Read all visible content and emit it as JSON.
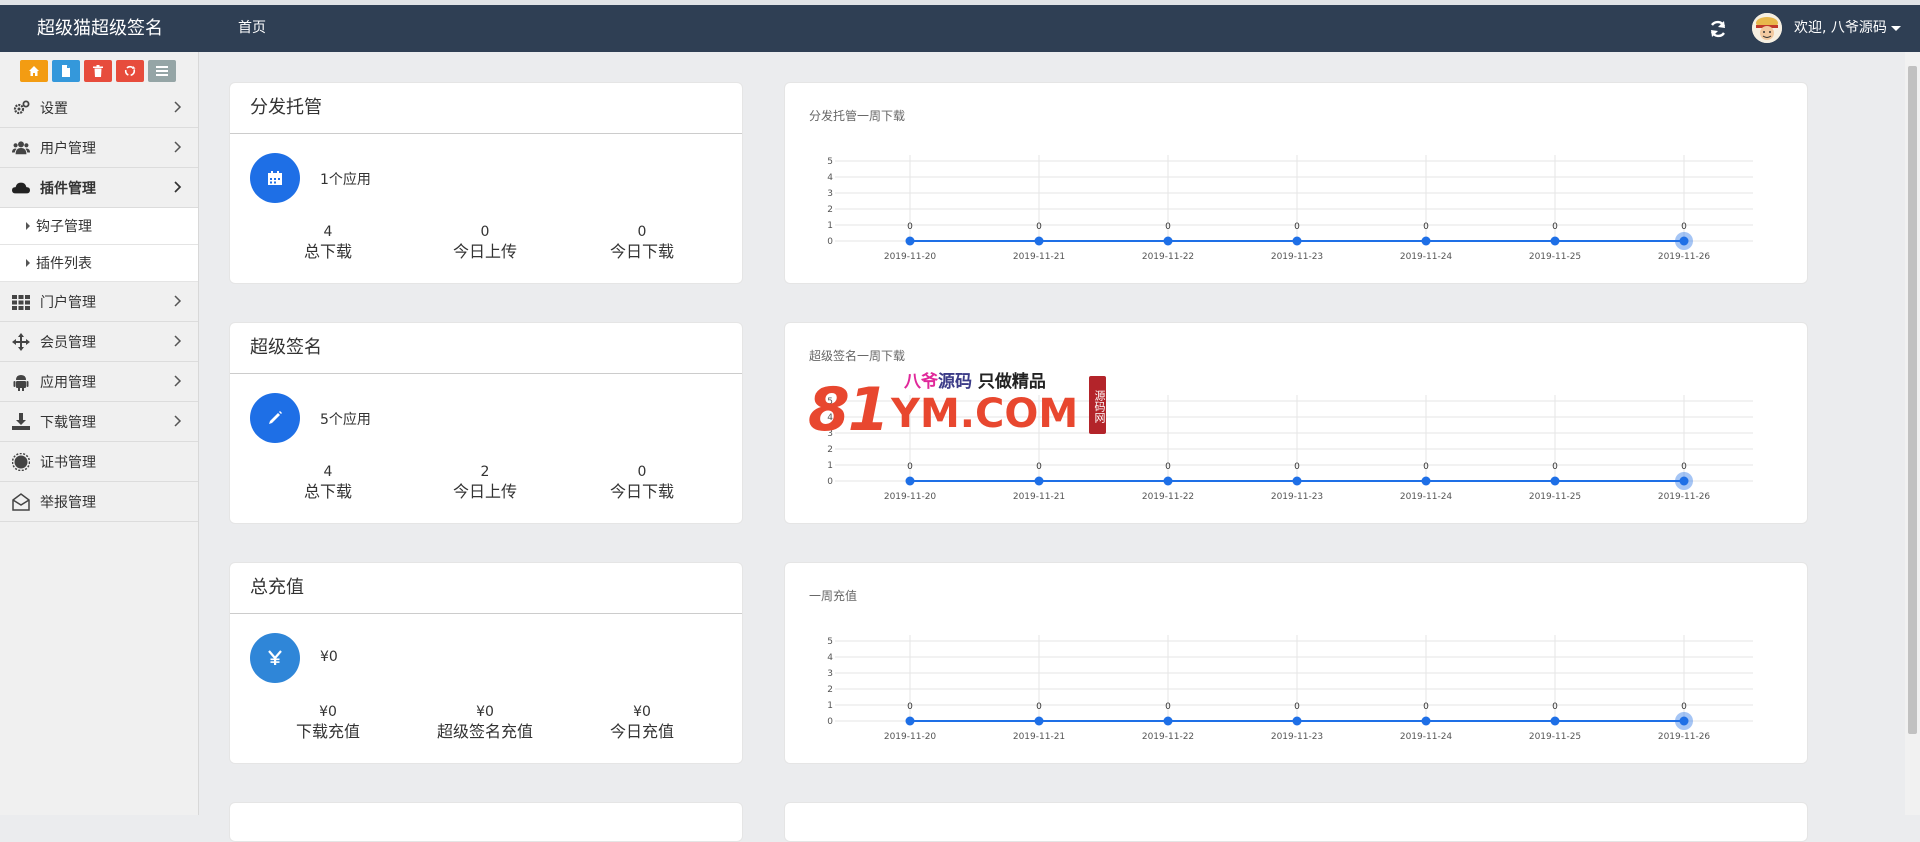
{
  "app": {
    "brand": "超级猫超级签名",
    "nav_home": "首页",
    "welcome": "欢迎, 八爷源码"
  },
  "shortcuts": [
    {
      "icon": "home-icon",
      "color": "#f39c12"
    },
    {
      "icon": "file-icon",
      "color": "#3498db"
    },
    {
      "icon": "trash-icon",
      "color": "#e74c3c"
    },
    {
      "icon": "recycle-icon",
      "color": "#e74c3c"
    },
    {
      "icon": "list-icon",
      "color": "#95a5a6"
    }
  ],
  "sidebar": {
    "items": [
      {
        "label": "设置",
        "icon": "cogs-icon",
        "chevron": true
      },
      {
        "label": "用户管理",
        "icon": "users-icon",
        "chevron": true
      },
      {
        "label": "插件管理",
        "icon": "cloud-icon",
        "chevron": true,
        "active": true
      },
      {
        "label": "门户管理",
        "icon": "grid-icon",
        "chevron": true
      },
      {
        "label": "会员管理",
        "icon": "move-icon",
        "chevron": true
      },
      {
        "label": "应用管理",
        "icon": "android-icon",
        "chevron": true
      },
      {
        "label": "下载管理",
        "icon": "download-icon",
        "chevron": true
      },
      {
        "label": "证书管理",
        "icon": "certificate-icon",
        "chevron": false
      },
      {
        "label": "举报管理",
        "icon": "envelope-icon",
        "chevron": false
      }
    ],
    "sub_items": [
      {
        "label": "钩子管理"
      },
      {
        "label": "插件列表"
      }
    ]
  },
  "stats": [
    {
      "title": "分发托管",
      "icon": "calendar-icon",
      "count": "1个应用",
      "cols": [
        {
          "value": "4",
          "label": "总下载"
        },
        {
          "value": "0",
          "label": "今日上传"
        },
        {
          "value": "0",
          "label": "今日下载"
        }
      ]
    },
    {
      "title": "超级签名",
      "icon": "pencil-icon",
      "count": "5个应用",
      "cols": [
        {
          "value": "4",
          "label": "总下载"
        },
        {
          "value": "2",
          "label": "今日上传"
        },
        {
          "value": "0",
          "label": "今日下载"
        }
      ]
    },
    {
      "title": "总充值",
      "icon": "yen-icon",
      "count": "¥0",
      "cols": [
        {
          "value": "¥0",
          "label": "下载充值"
        },
        {
          "value": "¥0",
          "label": "超级签名充值"
        },
        {
          "value": "¥0",
          "label": "今日充值"
        }
      ]
    }
  ],
  "chart_data": [
    {
      "type": "line",
      "title": "分发托管一周下载",
      "categories": [
        "2019-11-20",
        "2019-11-21",
        "2019-11-22",
        "2019-11-23",
        "2019-11-24",
        "2019-11-25",
        "2019-11-26"
      ],
      "values": [
        0,
        0,
        0,
        0,
        0,
        0,
        0
      ],
      "ylim": [
        0,
        5
      ],
      "yticks": [
        "0",
        "1",
        "2",
        "3",
        "4",
        "5"
      ],
      "grid": true,
      "line_color": "#1e6fe6"
    },
    {
      "type": "line",
      "title": "超级签名一周下载",
      "categories": [
        "2019-11-20",
        "2019-11-21",
        "2019-11-22",
        "2019-11-23",
        "2019-11-24",
        "2019-11-25",
        "2019-11-26"
      ],
      "values": [
        0,
        0,
        0,
        0,
        0,
        0,
        0
      ],
      "ylim": [
        0,
        5
      ],
      "yticks": [
        "0",
        "1",
        "2",
        "3",
        "4",
        "5"
      ],
      "grid": true,
      "line_color": "#1e6fe6"
    },
    {
      "type": "line",
      "title": "一周充值",
      "categories": [
        "2019-11-20",
        "2019-11-21",
        "2019-11-22",
        "2019-11-23",
        "2019-11-24",
        "2019-11-25",
        "2019-11-26"
      ],
      "values": [
        0,
        0,
        0,
        0,
        0,
        0,
        0
      ],
      "ylim": [
        0,
        5
      ],
      "yticks": [
        "0",
        "1",
        "2",
        "3",
        "4",
        "5"
      ],
      "grid": true,
      "line_color": "#1e6fe6"
    }
  ],
  "watermark": {
    "big": "81",
    "com": "YM.COM",
    "tag_p1": "八爷",
    "tag_p2": "源码",
    "tag_p3": " 只做精品",
    "seal": "源码网"
  }
}
